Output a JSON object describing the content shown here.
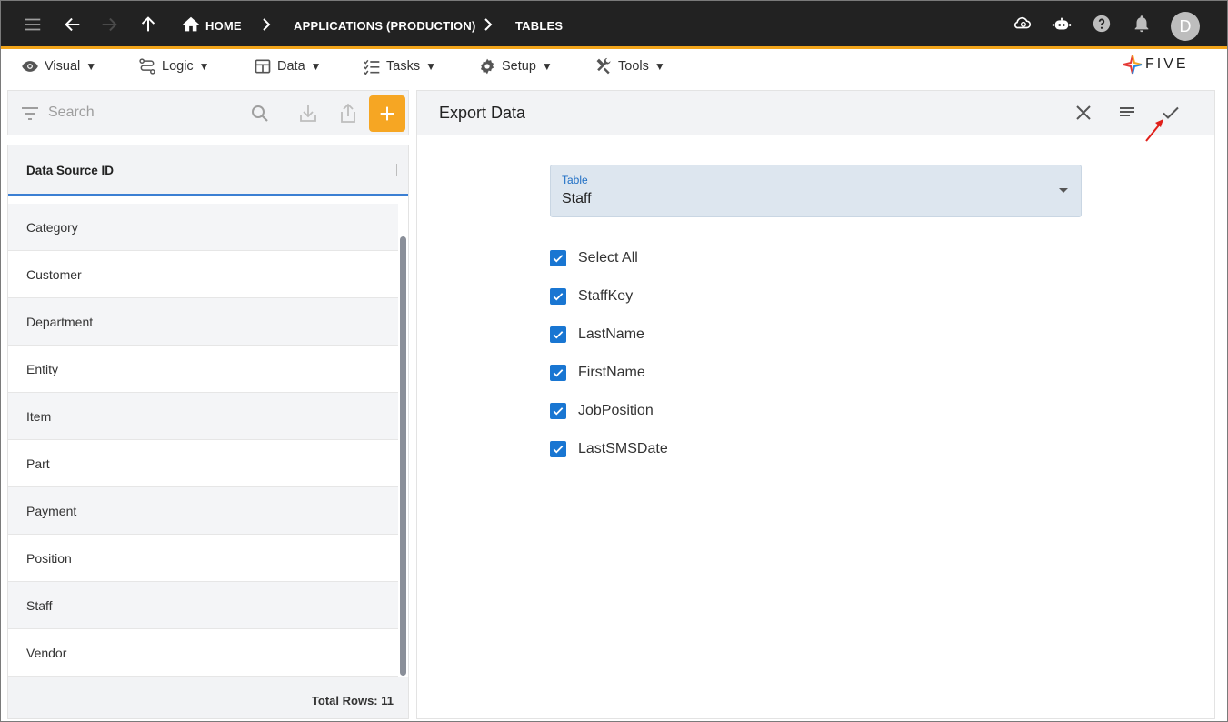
{
  "topbar": {
    "breadcrumbs": [
      "HOME",
      "APPLICATIONS (PRODUCTION)",
      "TABLES"
    ],
    "avatar_initial": "D",
    "accent_color": "#f2a51a"
  },
  "menu": {
    "items": [
      "Visual",
      "Logic",
      "Data",
      "Tasks",
      "Setup",
      "Tools"
    ],
    "caret": "▼"
  },
  "logo": {
    "text": "FIVE"
  },
  "left": {
    "search_placeholder": "Search",
    "column_header": "Data Source ID",
    "rows": [
      "Category",
      "Customer",
      "Department",
      "Entity",
      "Item",
      "Part",
      "Payment",
      "Position",
      "Staff",
      "Vendor"
    ],
    "total_rows_label": "Total Rows: 11"
  },
  "form": {
    "title": "Export Data",
    "table_label": "Table",
    "table_value": "Staff",
    "fields": [
      {
        "label": "Select All",
        "checked": true
      },
      {
        "label": "StaffKey",
        "checked": true
      },
      {
        "label": "LastName",
        "checked": true
      },
      {
        "label": "FirstName",
        "checked": true
      },
      {
        "label": "JobPosition",
        "checked": true
      },
      {
        "label": "LastSMSDate",
        "checked": true
      }
    ]
  }
}
